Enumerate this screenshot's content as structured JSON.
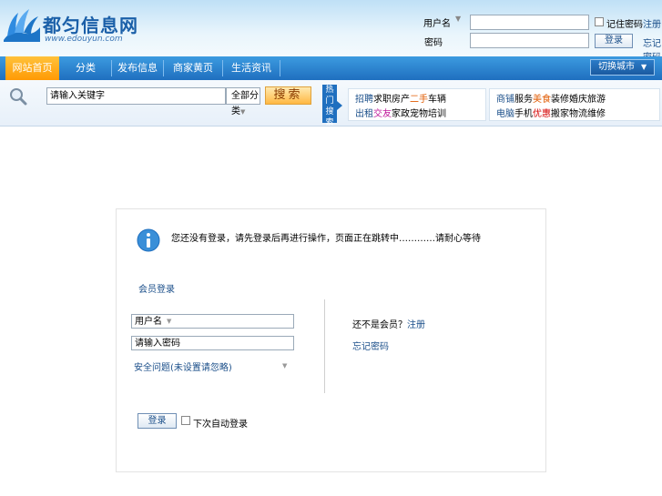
{
  "header": {
    "logo_text": "都匀信息网",
    "logo_url": "www.edouyun.com",
    "login": {
      "user_type_label": "用户名",
      "password_label": "密码",
      "remember_label": "记住密码",
      "submit_label": "登录",
      "link_register": "注册",
      "link_forgot": "忘记密码"
    }
  },
  "nav": {
    "items": [
      "网站首页",
      "分类",
      "发布信息",
      "商家黄页",
      "生活资讯"
    ],
    "city_label": "切换城市"
  },
  "search": {
    "placeholder": "请输入关键字",
    "category": "全部分类",
    "button": "搜索",
    "hot_tab": "热门搜索"
  },
  "hot_keywords": {
    "group1": [
      [
        {
          "t": "招聘",
          "c": "#1b4f8a"
        },
        {
          "t": "求职",
          "c": "#000000"
        },
        {
          "t": "房产",
          "c": "#000000"
        },
        {
          "t": "二手",
          "c": "#e05a00"
        },
        {
          "t": "车辆",
          "c": "#000000"
        }
      ],
      [
        {
          "t": "出租",
          "c": "#1b4f8a"
        },
        {
          "t": "交友",
          "c": "#c0189a"
        },
        {
          "t": "家政",
          "c": "#000000"
        },
        {
          "t": "宠物",
          "c": "#000000"
        },
        {
          "t": "培训",
          "c": "#000000"
        }
      ]
    ],
    "group2": [
      [
        {
          "t": "商铺",
          "c": "#1b4f8a"
        },
        {
          "t": "服务",
          "c": "#000000"
        },
        {
          "t": "美食",
          "c": "#e05a00"
        },
        {
          "t": "装修",
          "c": "#000000"
        },
        {
          "t": "婚庆",
          "c": "#000000"
        },
        {
          "t": "旅游",
          "c": "#000000"
        }
      ],
      [
        {
          "t": "电脑",
          "c": "#1b4f8a"
        },
        {
          "t": "手机",
          "c": "#000000"
        },
        {
          "t": "优惠",
          "c": "#d40000"
        },
        {
          "t": "搬家",
          "c": "#000000"
        },
        {
          "t": "物流",
          "c": "#000000"
        },
        {
          "t": "维修",
          "c": "#000000"
        }
      ]
    ]
  },
  "dialog": {
    "message": "您还没有登录，请先登录后再进行操作，页面正在跳转中…………请耐心等待",
    "section_title": "会员登录",
    "user_type": "用户名",
    "password_placeholder": "请输入密码",
    "safety_question": "安全问题(未设置请忽略)",
    "not_member": "还不是会员？",
    "not_member_link": "注册",
    "forgot": "忘记密码",
    "submit": "登录",
    "auto_login": "下次自动登录"
  }
}
